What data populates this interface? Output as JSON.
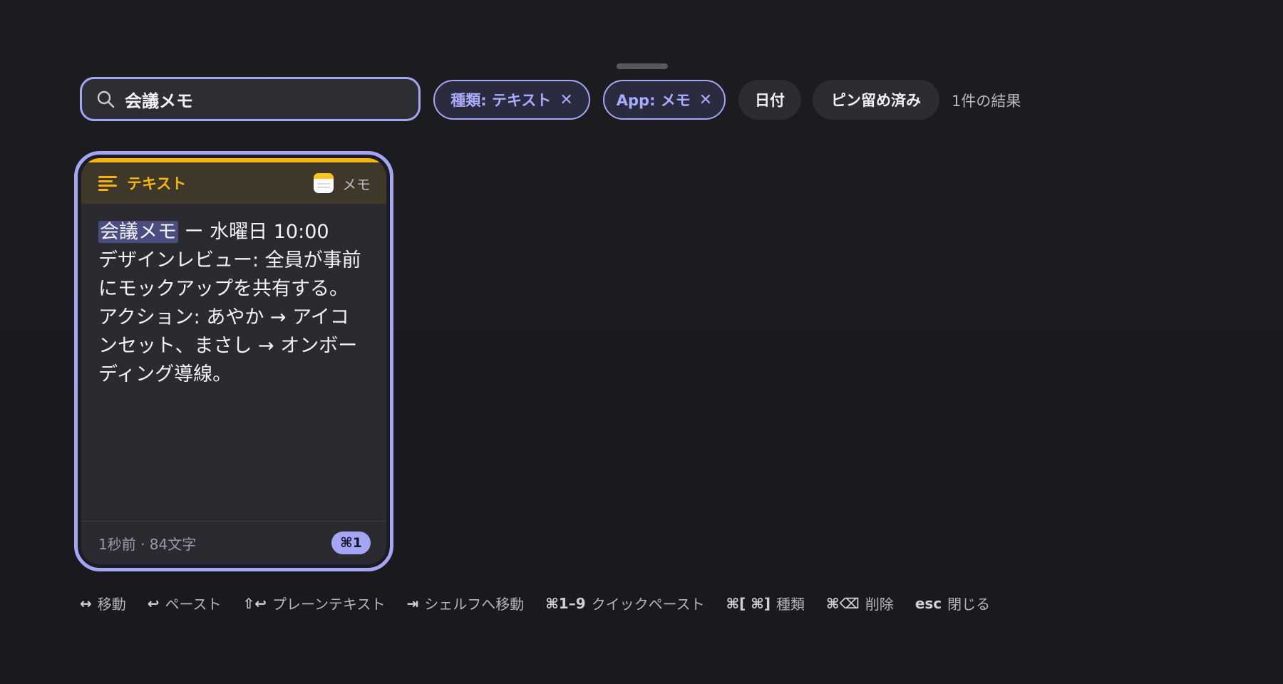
{
  "search": {
    "value": "会議メモ",
    "icon": "magnifier-icon"
  },
  "filters": [
    {
      "label": "種類: テキスト",
      "active": true,
      "remove_glyph": "✕"
    },
    {
      "label": "App: メモ",
      "active": true,
      "remove_glyph": "✕"
    },
    {
      "label": "日付",
      "active": false
    },
    {
      "label": "ピン留め済み",
      "active": false
    }
  ],
  "result_count": "1件の結果",
  "card": {
    "type_label": "テキスト",
    "type_icon": "text-lines-icon",
    "app_label": "メモ",
    "app_icon": "notes-app-icon",
    "highlight": "会議メモ",
    "title_rest": " ー 水曜日 10:00",
    "body_lines": [
      "デザインレビュー: 全員が事前にモックアップを共有する。",
      "アクション: あやか → アイコンセット、まさし → オンボーディング導線。"
    ],
    "meta": "1秒前 · 84文字",
    "shortcut": "⌘1",
    "accent": "#f6b512"
  },
  "shortcuts": [
    {
      "key": "↔",
      "label": "移動"
    },
    {
      "key": "↩",
      "label": "ペースト"
    },
    {
      "key": "⇧↩",
      "label": "プレーンテキスト"
    },
    {
      "key": "⇥",
      "label": "シェルフへ移動"
    },
    {
      "key": "⌘1–9",
      "label": "クイックペースト"
    },
    {
      "key": "⌘[ ⌘]",
      "label": "種類"
    },
    {
      "key": "⌘⌫",
      "label": "削除"
    },
    {
      "key": "esc",
      "label": "閉じる"
    }
  ],
  "colors": {
    "background": "#1a1a1f",
    "accent": "#a4a6f4",
    "text_type": "#f6b512"
  }
}
